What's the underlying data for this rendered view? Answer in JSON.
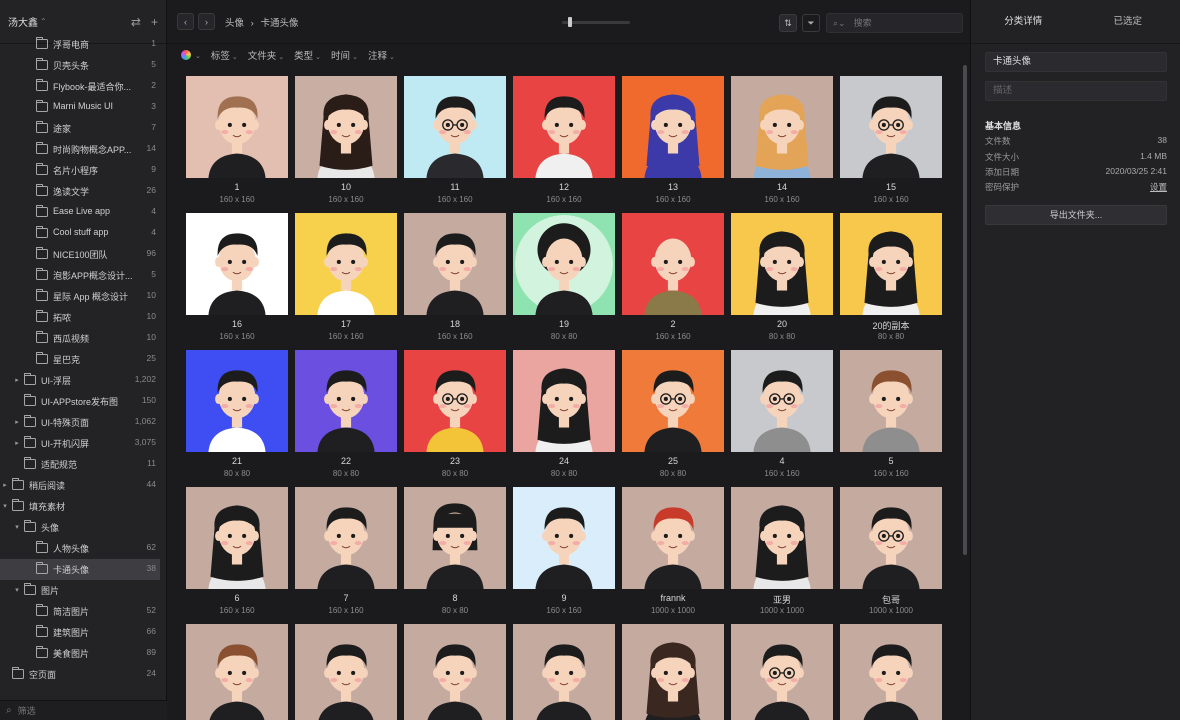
{
  "workspace": {
    "name": "汤大鑫",
    "add_icon": "plus-icon",
    "sync_icon": "swap-icon"
  },
  "sidebar": {
    "items": [
      {
        "label": "浮哥电商",
        "count": "1",
        "level": 2,
        "expand": ""
      },
      {
        "label": "贝壳头条",
        "count": "5",
        "level": 2,
        "expand": ""
      },
      {
        "label": "Flybook-最适合你...",
        "count": "2",
        "level": 2,
        "expand": ""
      },
      {
        "label": "Marni Music UI",
        "count": "3",
        "level": 2,
        "expand": ""
      },
      {
        "label": "途家",
        "count": "7",
        "level": 2,
        "expand": ""
      },
      {
        "label": "时尚购物概念APP...",
        "count": "14",
        "level": 2,
        "expand": ""
      },
      {
        "label": "名片小程序",
        "count": "9",
        "level": 2,
        "expand": ""
      },
      {
        "label": "逸读文学",
        "count": "26",
        "level": 2,
        "expand": ""
      },
      {
        "label": "Ease Live app",
        "count": "4",
        "level": 2,
        "expand": ""
      },
      {
        "label": "Cool stuff app",
        "count": "4",
        "level": 2,
        "expand": ""
      },
      {
        "label": "NICE100团队",
        "count": "96",
        "level": 2,
        "expand": ""
      },
      {
        "label": "泡影APP概念设计...",
        "count": "5",
        "level": 2,
        "expand": ""
      },
      {
        "label": "星际 App 概念设计",
        "count": "10",
        "level": 2,
        "expand": ""
      },
      {
        "label": "拓哝",
        "count": "10",
        "level": 2,
        "expand": ""
      },
      {
        "label": "西瓜视频",
        "count": "10",
        "level": 2,
        "expand": ""
      },
      {
        "label": "星巴克",
        "count": "25",
        "level": 2,
        "expand": ""
      },
      {
        "label": "UI-浮层",
        "count": "1,202",
        "level": 1,
        "expand": "closed"
      },
      {
        "label": "UI-APPstore发布图",
        "count": "150",
        "level": 1,
        "expand": ""
      },
      {
        "label": "UI-特殊页面",
        "count": "1,062",
        "level": 1,
        "expand": "closed"
      },
      {
        "label": "UI-开机闪屏",
        "count": "3,075",
        "level": 1,
        "expand": "closed"
      },
      {
        "label": "适配规范",
        "count": "11",
        "level": 1,
        "expand": ""
      },
      {
        "label": "稍后阅读",
        "count": "44",
        "level": 0,
        "expand": "closed"
      },
      {
        "label": "填充素材",
        "count": "",
        "level": 0,
        "expand": "open"
      },
      {
        "label": "头像",
        "count": "",
        "level": 1,
        "expand": "open"
      },
      {
        "label": "人物头像",
        "count": "62",
        "level": 2,
        "expand": ""
      },
      {
        "label": "卡通头像",
        "count": "38",
        "level": 2,
        "expand": "",
        "selected": true
      },
      {
        "label": "图片",
        "count": "",
        "level": 1,
        "expand": "open"
      },
      {
        "label": "简洁图片",
        "count": "52",
        "level": 2,
        "expand": ""
      },
      {
        "label": "建筑图片",
        "count": "66",
        "level": 2,
        "expand": ""
      },
      {
        "label": "美食图片",
        "count": "89",
        "level": 2,
        "expand": ""
      },
      {
        "label": "空页面",
        "count": "24",
        "level": 0,
        "expand": ""
      }
    ],
    "filter_placeholder": "筛选"
  },
  "toolbar": {
    "back_icon": "chevron-left-icon",
    "forward_icon": "chevron-right-icon",
    "breadcrumb": [
      "头像",
      "›",
      "卡通头像"
    ],
    "search_placeholder": "搜索"
  },
  "filters": {
    "tag": "标签",
    "folder": "文件夹",
    "type": "类型",
    "time": "时间",
    "note": "注释"
  },
  "grid": {
    "items": [
      {
        "name": "1",
        "dim": "160 x 160",
        "bg": "#e2bfb1",
        "skin": "#f6d4bc",
        "hair": "#a07050",
        "hair_style": "short",
        "shirt": "#1f1f22",
        "glasses": false
      },
      {
        "name": "10",
        "dim": "160 x 160",
        "bg": "#c9aea3",
        "skin": "#f6d4bc",
        "hair": "#2a1c16",
        "hair_style": "long",
        "shirt": "#e8e8e8",
        "glasses": false
      },
      {
        "name": "11",
        "dim": "160 x 160",
        "bg": "#bfeaf3",
        "skin": "#f6d4bc",
        "hair": "#1c1c1c",
        "hair_style": "short",
        "shirt": "#2a2a2e",
        "glasses": true
      },
      {
        "name": "12",
        "dim": "160 x 160",
        "bg": "#e84444",
        "skin": "#f6d4bc",
        "hair": "#1c1c1c",
        "hair_style": "short",
        "shirt": "#f0f0f0",
        "glasses": false
      },
      {
        "name": "13",
        "dim": "160 x 160",
        "bg": "#f06a2d",
        "skin": "#f6d4bc",
        "hair": "#3b3aa8",
        "hair_style": "hood",
        "shirt": "#3b3aa8",
        "glasses": false
      },
      {
        "name": "14",
        "dim": "160 x 160",
        "bg": "#c5aaa0",
        "skin": "#f6d4bc",
        "hair": "#e3a457",
        "hair_style": "long",
        "shirt": "#8fb3d8",
        "glasses": false
      },
      {
        "name": "15",
        "dim": "160 x 160",
        "bg": "#c8c9cc",
        "skin": "#f6d4bc",
        "hair": "#1c1c1c",
        "hair_style": "short",
        "shirt": "#1f1f22",
        "glasses": true
      },
      {
        "name": "16",
        "dim": "160 x 160",
        "bg": "#ffffff",
        "skin": "#f6d4bc",
        "hair": "#1c1c1c",
        "hair_style": "short",
        "shirt": "#1f1f22",
        "glasses": false
      },
      {
        "name": "17",
        "dim": "160 x 160",
        "bg": "#f7d14c",
        "skin": "#f6d4bc",
        "hair": "#1c1c1c",
        "hair_style": "short",
        "shirt": "#ffffff",
        "glasses": false
      },
      {
        "name": "18",
        "dim": "160 x 160",
        "bg": "#c5aaa0",
        "skin": "#f6d4bc",
        "hair": "#1c1c1c",
        "hair_style": "short",
        "shirt": "#1f1f22",
        "glasses": false
      },
      {
        "name": "19",
        "dim": "80 x 80",
        "bg": "#8fe3b0",
        "skin": "#f6d4bc",
        "hair": "#1c1c1c",
        "hair_style": "afro",
        "shirt": "#1f1f22",
        "glasses": false
      },
      {
        "name": "2",
        "dim": "160 x 160",
        "bg": "#e84444",
        "skin": "#f6d4bc",
        "hair": "#f6d4bc",
        "hair_style": "bald",
        "shirt": "#8a7a4a",
        "glasses": false
      },
      {
        "name": "20",
        "dim": "80 x 80",
        "bg": "#f7c84c",
        "skin": "#f6d4bc",
        "hair": "#1c1c1c",
        "hair_style": "long",
        "shirt": "#f0f0f0",
        "glasses": false
      },
      {
        "name": "20的副本",
        "dim": "80 x 80",
        "bg": "#f7c84c",
        "skin": "#f6d4bc",
        "hair": "#1c1c1c",
        "hair_style": "long",
        "shirt": "#f0f0f0",
        "glasses": false
      },
      {
        "name": "21",
        "dim": "80 x 80",
        "bg": "#3f4ef2",
        "skin": "#f6d4bc",
        "hair": "#1c1c1c",
        "hair_style": "short",
        "shirt": "#ffffff",
        "glasses": false
      },
      {
        "name": "22",
        "dim": "80 x 80",
        "bg": "#6a4fe0",
        "skin": "#f6d4bc",
        "hair": "#1c1c1c",
        "hair_style": "short",
        "shirt": "#1f1f22",
        "glasses": false
      },
      {
        "name": "23",
        "dim": "80 x 80",
        "bg": "#e84444",
        "skin": "#f6d4bc",
        "hair": "#1c1c1c",
        "hair_style": "short",
        "shirt": "#f3c437",
        "glasses": true
      },
      {
        "name": "24",
        "dim": "80 x 80",
        "bg": "#eba5a0",
        "skin": "#f6d4bc",
        "hair": "#1c1c1c",
        "hair_style": "long",
        "shirt": "#f0f0f0",
        "glasses": false
      },
      {
        "name": "25",
        "dim": "80 x 80",
        "bg": "#f07a3a",
        "skin": "#f6d4bc",
        "hair": "#1c1c1c",
        "hair_style": "short",
        "shirt": "#1f1f22",
        "glasses": true
      },
      {
        "name": "4",
        "dim": "160 x 160",
        "bg": "#c8c9cc",
        "skin": "#f6d4bc",
        "hair": "#1c1c1c",
        "hair_style": "short",
        "shirt": "#8e8e8e",
        "glasses": true
      },
      {
        "name": "5",
        "dim": "160 x 160",
        "bg": "#c5aaa0",
        "skin": "#f6d4bc",
        "hair": "#8a5030",
        "hair_style": "short",
        "shirt": "#8e8e8e",
        "glasses": false
      },
      {
        "name": "6",
        "dim": "160 x 160",
        "bg": "#c5aaa0",
        "skin": "#f6d4bc",
        "hair": "#1c1c1c",
        "hair_style": "long",
        "shirt": "#e8e8e8",
        "glasses": false
      },
      {
        "name": "7",
        "dim": "160 x 160",
        "bg": "#c5aaa0",
        "skin": "#f6d4bc",
        "hair": "#1c1c1c",
        "hair_style": "short",
        "shirt": "#1f1f22",
        "glasses": false
      },
      {
        "name": "8",
        "dim": "80 x 80",
        "bg": "#c5aaa0",
        "skin": "#f6d4bc",
        "hair": "#1c1c1c",
        "hair_style": "bob",
        "shirt": "#1f1f22",
        "glasses": false
      },
      {
        "name": "9",
        "dim": "160 x 160",
        "bg": "#d9eefa",
        "skin": "#f6d4bc",
        "hair": "#1c1c1c",
        "hair_style": "short",
        "shirt": "#1f1f22",
        "glasses": false
      },
      {
        "name": "frannk",
        "dim": "1000 x 1000",
        "bg": "#c5aaa0",
        "skin": "#f6d4bc",
        "hair": "#c83a2a",
        "hair_style": "short",
        "shirt": "#1f1f22",
        "glasses": false
      },
      {
        "name": "亚男",
        "dim": "1000 x 1000",
        "bg": "#c5aaa0",
        "skin": "#f6d4bc",
        "hair": "#1c1c1c",
        "hair_style": "long",
        "shirt": "#e8e8e8",
        "glasses": false
      },
      {
        "name": "包哥",
        "dim": "1000 x 1000",
        "bg": "#c5aaa0",
        "skin": "#f6d4bc",
        "hair": "#1c1c1c",
        "hair_style": "short",
        "shirt": "#1f1f22",
        "glasses": true
      },
      {
        "name": "",
        "dim": "",
        "bg": "#c5aaa0",
        "skin": "#f6d4bc",
        "hair": "#8a5030",
        "hair_style": "short",
        "shirt": "#1f1f22",
        "glasses": false
      },
      {
        "name": "",
        "dim": "",
        "bg": "#c5aaa0",
        "skin": "#f6d4bc",
        "hair": "#1c1c1c",
        "hair_style": "short",
        "shirt": "#1f1f22",
        "glasses": false
      },
      {
        "name": "",
        "dim": "",
        "bg": "#c5aaa0",
        "skin": "#f6d4bc",
        "hair": "#1c1c1c",
        "hair_style": "short",
        "shirt": "#1f1f22",
        "glasses": false
      },
      {
        "name": "",
        "dim": "",
        "bg": "#c5aaa0",
        "skin": "#f6d4bc",
        "hair": "#1c1c1c",
        "hair_style": "short",
        "shirt": "#1f1f22",
        "glasses": false
      },
      {
        "name": "",
        "dim": "",
        "bg": "#c5aaa0",
        "skin": "#f6d4bc",
        "hair": "#3a2820",
        "hair_style": "long",
        "shirt": "#1f1f22",
        "glasses": false
      },
      {
        "name": "",
        "dim": "",
        "bg": "#c5aaa0",
        "skin": "#f6d4bc",
        "hair": "#1c1c1c",
        "hair_style": "short",
        "shirt": "#1f1f22",
        "glasses": true
      },
      {
        "name": "",
        "dim": "",
        "bg": "#c5aaa0",
        "skin": "#f6d4bc",
        "hair": "#1c1c1c",
        "hair_style": "short",
        "shirt": "#1f1f22",
        "glasses": false
      }
    ]
  },
  "panel": {
    "tabs": [
      "分类详情",
      "已选定"
    ],
    "name_value": "卡通头像",
    "desc_placeholder": "描述",
    "section_title": "基本信息",
    "info": [
      {
        "key": "文件数",
        "value": "38"
      },
      {
        "key": "文件大小",
        "value": "1.4 MB"
      },
      {
        "key": "添加日期",
        "value": "2020/03/25 2:41"
      },
      {
        "key": "密码保护",
        "value": "设置"
      }
    ],
    "export_label": "导出文件夹..."
  },
  "colors": {
    "accent": "#3d3d42",
    "background": "#1b1b1d"
  }
}
